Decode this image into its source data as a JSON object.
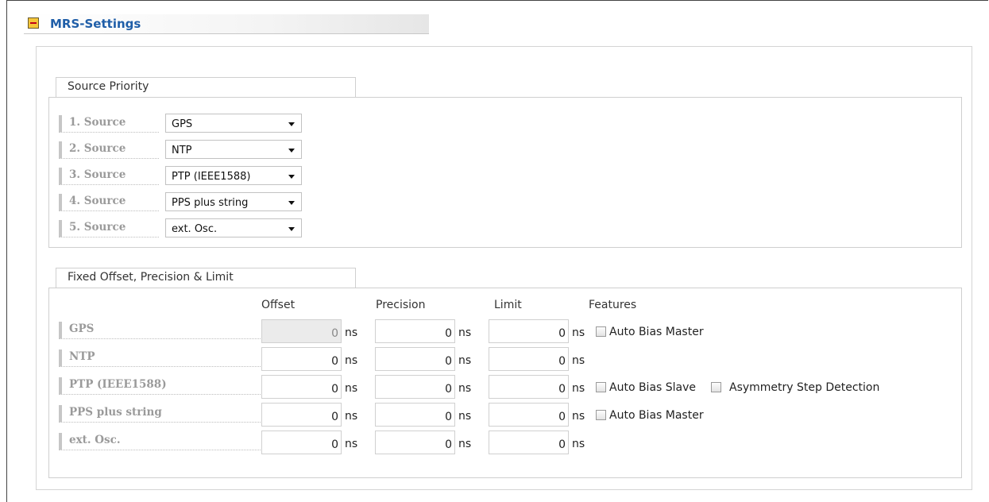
{
  "header": {
    "title": "MRS-Settings"
  },
  "source_priority": {
    "title": "Source Priority",
    "rows": [
      {
        "label": "1. Source",
        "value": "GPS"
      },
      {
        "label": "2. Source",
        "value": "NTP"
      },
      {
        "label": "3. Source",
        "value": "PTP (IEEE1588)"
      },
      {
        "label": "4. Source",
        "value": "PPS plus string"
      },
      {
        "label": "5. Source",
        "value": "ext. Osc."
      }
    ]
  },
  "offset_section": {
    "title": "Fixed Offset, Precision & Limit",
    "columns": {
      "offset": "Offset",
      "precision": "Precision",
      "limit": "Limit",
      "features": "Features"
    },
    "unit": "ns",
    "rows": [
      {
        "label": "GPS",
        "offset": "0",
        "precision": "0",
        "limit": "0",
        "feature1": "Auto Bias Master"
      },
      {
        "label": "NTP",
        "offset": "0",
        "precision": "0",
        "limit": "0"
      },
      {
        "label": "PTP (IEEE1588)",
        "offset": "0",
        "precision": "0",
        "limit": "0",
        "feature1": "Auto Bias Slave",
        "feature2": "Asymmetry Step Detection"
      },
      {
        "label": "PPS plus string",
        "offset": "0",
        "precision": "0",
        "limit": "0",
        "feature1": "Auto Bias Master"
      },
      {
        "label": "ext. Osc.",
        "offset": "0",
        "precision": "0",
        "limit": "0"
      }
    ]
  }
}
